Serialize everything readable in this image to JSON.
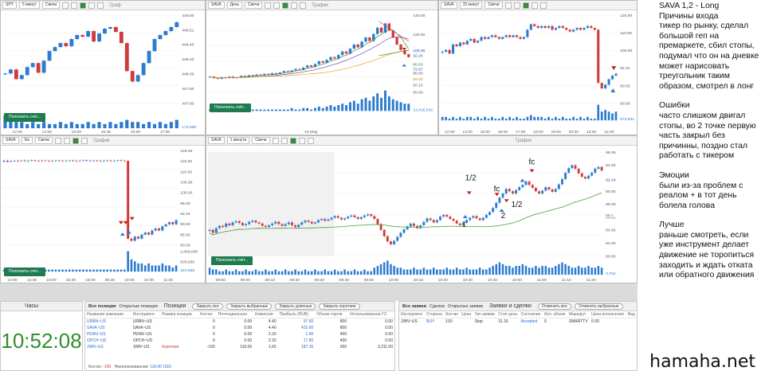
{
  "charts": {
    "spy": {
      "symbol": "SPY",
      "timeframe": "5 минут",
      "chart_type": "Свечи",
      "title": "Граф",
      "prices": [
        "448.60",
        "448.51",
        "448.40",
        "448.20",
        "448.00",
        "447.80",
        "447.60"
      ],
      "times": [
        "12:00",
        "14:00",
        "15:00",
        "15:45",
        "16:00",
        "17:00"
      ],
      "volume": "174,599",
      "topup": "Пополнить счёт..."
    },
    "sava_day": {
      "symbol": "SAVA",
      "timeframe": "День",
      "chart_type": "Свечи",
      "title": "График",
      "prices": [
        "140.00",
        "120.00",
        "100.00",
        "80.00",
        "60.00"
      ],
      "tags": [
        {
          "text": "100.00",
          "color": "#1f4fa8"
        },
        {
          "text": "92.24",
          "color": "#1f4fa8"
        },
        {
          "text": "80.00",
          "color": "#2f8f2f"
        },
        {
          "text": "72.87",
          "color": "#1f4fa8"
        },
        {
          "text": "59.00",
          "color": "#c88b1a"
        },
        {
          "text": "50.15",
          "color": "#7f3fbf"
        }
      ],
      "times": [
        "10 Мар"
      ],
      "volume": "13,416,542",
      "topup": "Пополнить счёт..."
    },
    "sava_15": {
      "symbol": "SAVA",
      "timeframe": "15 минут",
      "chart_type": "Свечи",
      "prices": [
        "120.00",
        "110.00",
        "100.00",
        "92.24",
        "90.00",
        "80.00"
      ],
      "times": [
        "12:00",
        "14:00",
        "15:00",
        "16:00",
        "17:00",
        "18:00",
        "19:00",
        "20:00",
        "13:00",
        "12:00"
      ],
      "volume": "673,831"
    },
    "sava_5": {
      "symbol": "SAVA",
      "timeframe": "5м",
      "chart_type": "Свечи",
      "title": "График",
      "prices": [
        "120.00",
        "115.00",
        "110.00",
        "105.00",
        "100.00",
        "95.00",
        "92.24",
        "90.00",
        "85.00",
        "80.00"
      ],
      "times": [
        "14:00",
        "14:30",
        "15:00",
        "15:30",
        "16:00",
        "09:30",
        "10:00",
        "10:30",
        "11:00"
      ],
      "volume_scale": [
        "1,000,000",
        "500,000"
      ],
      "volume": "223,665",
      "topup": "Пополнить счёт..."
    },
    "sava_1": {
      "symbol": "SAVA",
      "timeframe": "1 минута",
      "chart_type": "Свечи",
      "title": "График",
      "prices": [
        "96.00",
        "94.00",
        "92.00",
        "90.00",
        "88.00",
        "86.00",
        "84.00",
        "82.00",
        "80.00"
      ],
      "tags": [
        {
          "text": "92.24",
          "color": "#1f4fa8"
        },
        {
          "text": "86.1",
          "color": "#2f8f2f"
        }
      ],
      "times": [
        "09:50",
        "09:00",
        "09:10",
        "09:20",
        "09:30",
        "09:40",
        "09:50",
        "10:00",
        "10:10",
        "10:20",
        "10:30",
        "10:40",
        "10:50",
        "11:00",
        "11:10",
        "11:20"
      ],
      "volume": "3,704",
      "topup": "Пополнить счёт...",
      "annotations": [
        "1/2",
        "fc",
        "fc",
        "1",
        "2",
        "1/2"
      ]
    }
  },
  "clock": {
    "title": "Часы",
    "time": "10:52:08"
  },
  "positions": {
    "tabs": [
      "Все позиции",
      "Открытые позиции"
    ],
    "heading": "Позиции",
    "buttons": [
      "Закрыть все",
      "Закрыть выбранные",
      "Закрыть длинные",
      "Закрыть короткие"
    ],
    "columns": [
      "Название компании",
      "Инструмент",
      "Размер позиции",
      "Кол-во",
      "Потенциальная",
      "Комиссия",
      "Прибыль (RUB)",
      "Объем торгов",
      "Использованная ГО"
    ],
    "rows": [
      [
        "URBN~US",
        "URBN~US",
        "",
        "0",
        "0.00",
        "4.40",
        "97.60",
        "800",
        "0.00"
      ],
      [
        "SAVA~US",
        "SAVA~US",
        "",
        "0",
        "0.00",
        "4.40",
        "415.60",
        "800",
        "0.00"
      ],
      [
        "PENN~US",
        "PENN~US",
        "",
        "0",
        "0.00",
        "2.20",
        "1.80",
        "400",
        "0.00"
      ],
      [
        "OPCH~US",
        "OPCH~US",
        "",
        "0",
        "0.00",
        "2.20",
        "17.80",
        "400",
        "0.00"
      ],
      [
        "JWN~US",
        "JWN~US",
        "Короткая",
        "-100",
        "116.00",
        "1.65",
        "187.35",
        "300",
        "3,211.00"
      ]
    ],
    "footer_qty_label": "Кол-во:",
    "footer_qty": "-100",
    "footer_unrealized_label": "Нереализованная:",
    "footer_unrealized": "116.00 USD"
  },
  "orders": {
    "tabs": [
      "Все заявки",
      "Сделки",
      "Открытые заявки"
    ],
    "heading": "Заявки и сделки",
    "buttons": [
      "Отменить все",
      "Отменить выбранные"
    ],
    "columns": [
      "Инструмент",
      "Сторона",
      "Кол-во",
      "Цена",
      "Тип заявки",
      "Стоп цена",
      "Состояние",
      "Исп. объем",
      "Маршрут",
      "Цена исполнения",
      "Вед"
    ],
    "rows": [
      [
        "JWN~US",
        "BUY",
        "100",
        "",
        "Stop",
        "31.16",
        "Accepted",
        "0",
        "SMARTTV",
        "0.00",
        ""
      ]
    ]
  },
  "notes": {
    "header": "SAVA 1,2 - Long",
    "reasons_title": "Причины входа",
    "reasons": "тикер по рынку, сделал большой геп на премаркете, сбил стопы, подумал что он на дневке может нарисовать треугольник таким образом, смотрел в лонг",
    "errors_title": "Ошибки",
    "errors": "часто слишком двигал стопы, во 2 точке первую часть закрыл без причинны, поздно стал работать с тикером",
    "emotions_title": "Эмоции",
    "emotions": "были из-за проблем с реалом +  в тот день болела голова",
    "better_title": "Лучше",
    "better": "раньше смотреть, если уже инструмент делает движение не торопиться заходить и ждать отката или обратного движения"
  },
  "watermark": "hamaha.net",
  "chart_data": [
    {
      "id": "spy",
      "type": "candlestick",
      "ylim": [
        447.55,
        448.65
      ],
      "close": [
        447.92,
        447.97,
        447.85,
        447.9,
        448.0,
        448.05,
        447.93,
        448.08,
        448.2,
        448.25,
        448.3,
        448.26,
        448.35,
        448.4,
        448.38,
        448.45,
        448.32,
        448.42,
        448.48,
        448.5,
        448.44,
        448.3,
        447.95,
        447.82,
        447.9,
        448.05,
        448.2,
        448.35,
        448.4,
        448.45,
        448.5,
        448.56
      ],
      "volume": [
        6,
        4,
        3,
        3,
        2,
        3,
        2,
        3,
        2,
        2,
        3,
        2,
        3,
        2,
        2,
        3,
        2,
        3,
        2,
        3,
        2,
        3,
        4,
        3,
        3,
        2,
        3,
        2,
        3,
        2,
        3,
        4
      ]
    },
    {
      "id": "sava_day",
      "type": "candlestick",
      "ylim": [
        40,
        150
      ],
      "close": [
        62,
        60,
        59,
        61,
        60,
        62,
        60,
        61,
        63,
        62,
        64,
        63,
        65,
        64,
        66,
        65,
        67,
        66,
        68,
        70,
        69,
        71,
        73,
        72,
        75,
        78,
        76,
        80,
        84,
        82,
        86,
        90,
        88,
        93,
        98,
        95,
        102,
        108,
        104,
        112,
        118,
        113,
        123,
        132,
        125,
        138,
        128,
        118,
        108,
        100,
        94,
        90
      ],
      "volume": [
        1,
        1,
        1,
        1,
        1,
        1,
        1,
        1,
        1,
        1,
        1,
        1,
        1,
        1,
        1,
        1,
        1,
        1,
        1,
        1,
        1,
        2,
        1,
        1,
        2,
        2,
        1,
        2,
        3,
        2,
        3,
        4,
        3,
        4,
        5,
        4,
        6,
        7,
        5,
        8,
        9,
        7,
        10,
        12,
        9,
        14,
        10,
        8,
        7,
        6,
        5,
        5
      ]
    },
    {
      "id": "sava_15",
      "type": "candlestick",
      "ylim": [
        76,
        124
      ],
      "close": [
        104,
        105,
        103,
        108,
        107,
        109,
        108,
        110,
        111,
        109,
        110,
        112,
        111,
        112,
        113,
        112,
        111,
        112,
        113,
        112,
        113,
        112,
        111,
        112,
        116,
        119,
        118,
        117,
        118,
        117,
        118,
        116,
        117,
        118,
        117,
        116,
        115,
        116,
        117,
        116,
        117,
        118,
        117,
        116,
        87,
        84,
        86,
        89,
        91,
        92
      ],
      "volume": [
        2,
        2,
        1,
        2,
        1,
        2,
        1,
        2,
        2,
        1,
        2,
        1,
        2,
        1,
        2,
        1,
        1,
        2,
        1,
        2,
        1,
        2,
        1,
        1,
        2,
        3,
        2,
        2,
        2,
        1,
        2,
        1,
        2,
        1,
        2,
        1,
        1,
        2,
        1,
        2,
        1,
        2,
        1,
        1,
        9,
        5,
        6,
        5,
        4,
        5
      ]
    },
    {
      "id": "sava_5",
      "type": "candlestick",
      "ylim": [
        76,
        122
      ],
      "close": [
        117,
        116.5,
        116.8,
        117,
        116.9,
        117.1,
        116.8,
        117,
        117.2,
        117,
        116.9,
        117.1,
        117,
        116.8,
        117,
        117.1,
        117,
        116.9,
        117,
        117.1,
        117,
        116.9,
        117,
        117.2,
        116.9,
        117,
        117.1,
        117,
        116.8,
        117,
        117.1,
        116.9,
        117,
        117.2,
        117,
        116.9,
        79,
        78,
        80,
        79,
        81,
        82,
        81,
        83,
        84,
        83,
        85,
        86,
        87,
        86,
        88
      ],
      "volume": [
        1,
        1,
        1,
        1,
        1,
        1,
        1,
        1,
        1,
        1,
        1,
        1,
        1,
        1,
        1,
        1,
        1,
        1,
        1,
        1,
        1,
        1,
        1,
        1,
        1,
        1,
        1,
        1,
        1,
        1,
        1,
        1,
        1,
        1,
        1,
        1,
        10,
        6,
        5,
        4,
        4,
        3,
        4,
        3,
        3,
        3,
        4,
        3,
        3,
        2,
        3
      ]
    },
    {
      "id": "sava_1",
      "type": "candlestick",
      "ylim": [
        79,
        97
      ],
      "close": [
        83.5,
        83,
        83.8,
        84.2,
        84,
        84.6,
        84.3,
        84.8,
        85,
        84.7,
        84.3,
        84.5,
        84.9,
        85.1,
        84.8,
        84.6,
        84.2,
        84,
        84.3,
        84.6,
        84.9,
        84.5,
        84.2,
        84.5,
        84.8,
        84.3,
        84,
        84.4,
        84.8,
        85.1,
        84.9,
        84.6,
        84.8,
        85.2,
        85.4,
        85.1,
        85.3,
        85.6,
        85.9,
        85.6,
        85.3,
        85.5,
        85.8,
        86,
        85.7,
        85.4,
        85.7,
        86,
        86.2,
        85.9,
        85.4,
        84.5,
        83.5,
        82.4,
        81.5,
        81,
        81.6,
        82.3,
        83,
        83.6,
        84.1,
        84.6,
        84.2,
        83.8,
        84.3,
        84.9,
        85.5,
        85.2,
        84.8,
        85.2,
        85.8,
        86.1,
        85.8,
        85.4,
        85.1,
        84.6,
        84.3,
        84.7,
        85.2,
        85.6,
        85.9,
        85.5,
        85.2,
        85.6,
        86.1,
        86.6,
        87.3,
        88.2,
        89.1,
        89.8,
        90.6,
        90.2,
        89.8,
        90.4,
        90.9,
        91.3,
        91.9,
        91.3,
        90.8,
        90.2,
        89.8,
        90.3,
        90.9,
        90.5,
        90.1,
        90.6,
        91.4,
        92.3,
        93.4,
        94.2,
        94.7,
        94.1,
        93.3,
        92.7,
        92.4,
        92.9,
        93.4,
        94.1,
        94.4,
        93.8
      ],
      "volume": [
        4,
        3,
        3,
        2,
        2,
        3,
        2,
        2,
        3,
        2,
        2,
        3,
        2,
        2,
        3,
        2,
        2,
        3,
        2,
        2,
        3,
        2,
        2,
        3,
        2,
        2,
        3,
        2,
        2,
        3,
        2,
        2,
        3,
        2,
        2,
        3,
        2,
        2,
        3,
        2,
        2,
        3,
        2,
        2,
        3,
        2,
        2,
        3,
        2,
        2,
        4,
        5,
        6,
        7,
        8,
        6,
        5,
        4,
        4,
        3,
        3,
        3,
        4,
        3,
        3,
        4,
        3,
        3,
        4,
        3,
        3,
        3,
        4,
        3,
        3,
        4,
        3,
        3,
        4,
        3,
        3,
        3,
        4,
        3,
        3,
        4,
        5,
        6,
        7,
        6,
        5,
        5,
        4,
        5,
        5,
        6,
        5,
        4,
        4,
        5,
        4,
        5,
        5,
        4,
        4,
        5,
        6,
        7,
        6,
        5,
        4,
        4,
        5,
        4,
        4,
        5,
        4,
        4,
        5,
        4
      ]
    }
  ]
}
